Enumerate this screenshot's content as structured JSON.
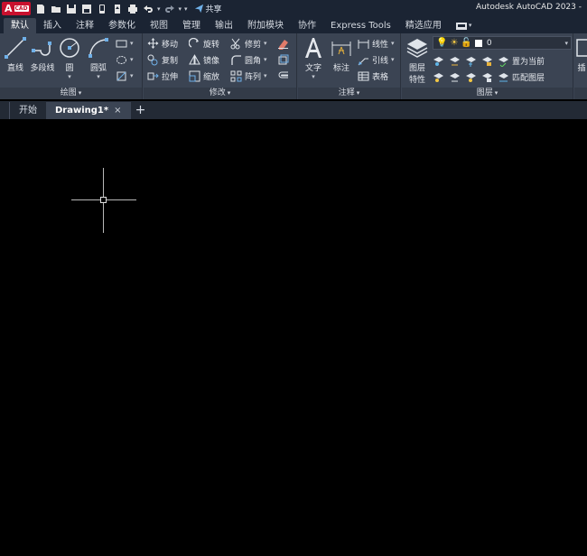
{
  "titlebar": {
    "logo_letter": "A",
    "logo_suffix": "CAD",
    "share_label": "共享",
    "window_title": "Autodesk AutoCAD 2023 -"
  },
  "ribbon_tabs": [
    {
      "label": "默认",
      "active": true
    },
    {
      "label": "插入"
    },
    {
      "label": "注释"
    },
    {
      "label": "参数化"
    },
    {
      "label": "视图"
    },
    {
      "label": "管理"
    },
    {
      "label": "输出"
    },
    {
      "label": "附加模块"
    },
    {
      "label": "协作"
    },
    {
      "label": "Express Tools"
    },
    {
      "label": "精选应用"
    }
  ],
  "panels": {
    "draw": {
      "title": "绘图",
      "line": "直线",
      "polyline": "多段线",
      "circle": "圆",
      "arc": "圆弧"
    },
    "modify": {
      "title": "修改",
      "move": "移动",
      "rotate": "旋转",
      "trim": "修剪",
      "copy": "复制",
      "mirror": "镜像",
      "fillet": "圆角",
      "stretch": "拉伸",
      "scale": "缩放",
      "array": "阵列"
    },
    "annotation": {
      "title": "注释",
      "text": "文字",
      "dimension": "标注",
      "linear": "线性",
      "leader": "引线",
      "table": "表格"
    },
    "layers": {
      "title": "图层",
      "layer_properties_line1": "图层",
      "layer_properties_line2": "特性",
      "current_layer": "0",
      "make_current": "置为当前",
      "match_layer": "匹配图层"
    },
    "insert": {
      "label": "插"
    }
  },
  "file_tabs": {
    "start": "开始",
    "drawing": "Drawing1*",
    "close": "×",
    "add": "+"
  },
  "colors": {
    "titlebar_bg": "#1b2433",
    "ribbon_bg": "#3b4453",
    "canvas_bg": "#000000",
    "accent_red": "#c8102e"
  }
}
